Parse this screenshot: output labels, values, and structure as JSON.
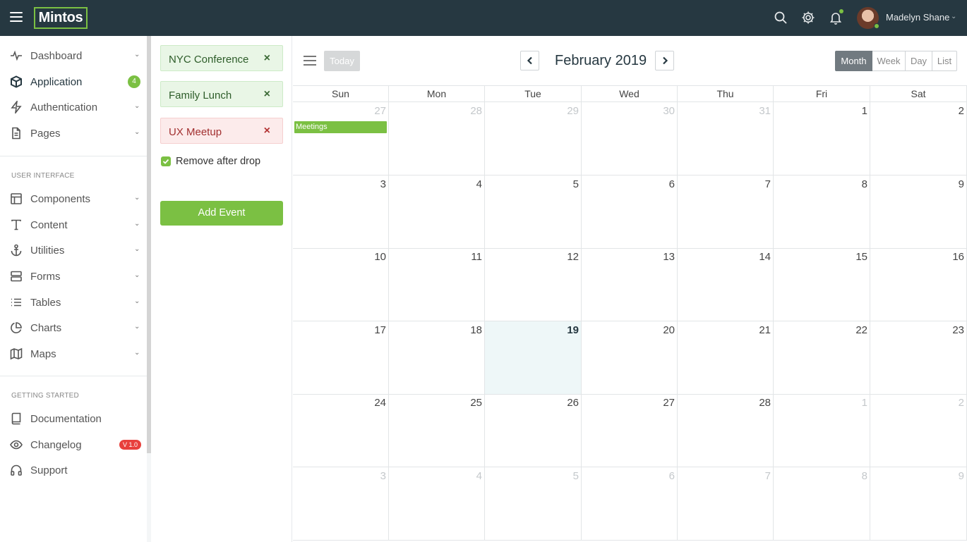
{
  "brand": {
    "logo_text": "Mintos",
    "accent": "#7bc043",
    "topbar_bg": "#263841"
  },
  "topbar": {
    "icons": [
      "menu-icon",
      "search-icon",
      "gear-icon",
      "bell-icon"
    ],
    "user_name": "Madelyn Shane"
  },
  "sidebar": {
    "items_top": [
      {
        "label": "Dashboard",
        "icon": "pulse-icon"
      },
      {
        "label": "Application",
        "icon": "box-icon",
        "badge": "4"
      },
      {
        "label": "Authentication",
        "icon": "bolt-icon"
      },
      {
        "label": "Pages",
        "icon": "file-icon"
      }
    ],
    "section_ui": "USER INTERFACE",
    "items_ui": [
      {
        "label": "Components",
        "icon": "layout-icon"
      },
      {
        "label": "Content",
        "icon": "type-icon"
      },
      {
        "label": "Utilities",
        "icon": "anchor-icon"
      },
      {
        "label": "Forms",
        "icon": "server-icon"
      },
      {
        "label": "Tables",
        "icon": "list-icon"
      },
      {
        "label": "Charts",
        "icon": "pie-chart-icon"
      },
      {
        "label": "Maps",
        "icon": "map-icon"
      }
    ],
    "section_gs": "GETTING STARTED",
    "items_gs": [
      {
        "label": "Documentation",
        "icon": "book-icon"
      },
      {
        "label": "Changelog",
        "icon": "eye-icon",
        "badge": "V 1.0"
      },
      {
        "label": "Support",
        "icon": "headphones-icon"
      }
    ]
  },
  "external_events": {
    "items": [
      {
        "label": "NYC Conference",
        "close": "×"
      },
      {
        "label": "Family Lunch",
        "close": "×"
      },
      {
        "label": "UX Meetup",
        "close": "×"
      }
    ],
    "remove_after_drop_label": "Remove after drop",
    "remove_after_drop_checked": true,
    "add_button_label": "Add Event"
  },
  "calendar": {
    "today_label": "Today",
    "title": "February 2019",
    "views": [
      "Month",
      "Week",
      "Day",
      "List"
    ],
    "active_view": "Month",
    "weekdays": [
      "Sun",
      "Mon",
      "Tue",
      "Wed",
      "Thu",
      "Fri",
      "Sat"
    ],
    "weeks": [
      [
        "27",
        "28",
        "29",
        "30",
        "31",
        "1",
        "2"
      ],
      [
        "3",
        "4",
        "5",
        "6",
        "7",
        "8",
        "9"
      ],
      [
        "10",
        "11",
        "12",
        "13",
        "14",
        "15",
        "16"
      ],
      [
        "17",
        "18",
        "19",
        "20",
        "21",
        "22",
        "23"
      ],
      [
        "24",
        "25",
        "26",
        "27",
        "28",
        "1",
        "2"
      ],
      [
        "3",
        "4",
        "5",
        "6",
        "7",
        "8",
        "9"
      ]
    ],
    "event": {
      "label": "Meetings",
      "date": "2019-01-27"
    },
    "today_date": "19"
  }
}
